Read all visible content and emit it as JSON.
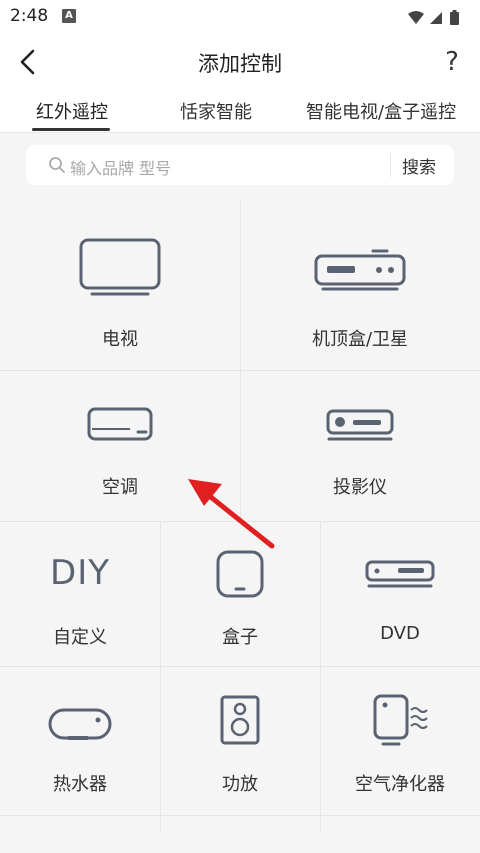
{
  "status": {
    "time": "2:48",
    "notif_letter": "A"
  },
  "header": {
    "title": "添加控制",
    "help": "?"
  },
  "tabs": [
    "红外遥控",
    "恬家智能",
    "智能电视/盒子遥控"
  ],
  "search": {
    "placeholder": "输入品牌 型号",
    "button": "搜索"
  },
  "devices": {
    "tv": "电视",
    "stb": "机顶盒/卫星",
    "ac": "空调",
    "projector": "投影仪",
    "diy": "自定义",
    "diy_icon_text": "DIY",
    "box": "盒子",
    "dvd": "DVD",
    "heater": "热水器",
    "amp": "功放",
    "purifier": "空气净化器"
  },
  "colors": {
    "icon": "#5a6372",
    "arrow": "#e02020",
    "bg": "#f5f5f5"
  }
}
